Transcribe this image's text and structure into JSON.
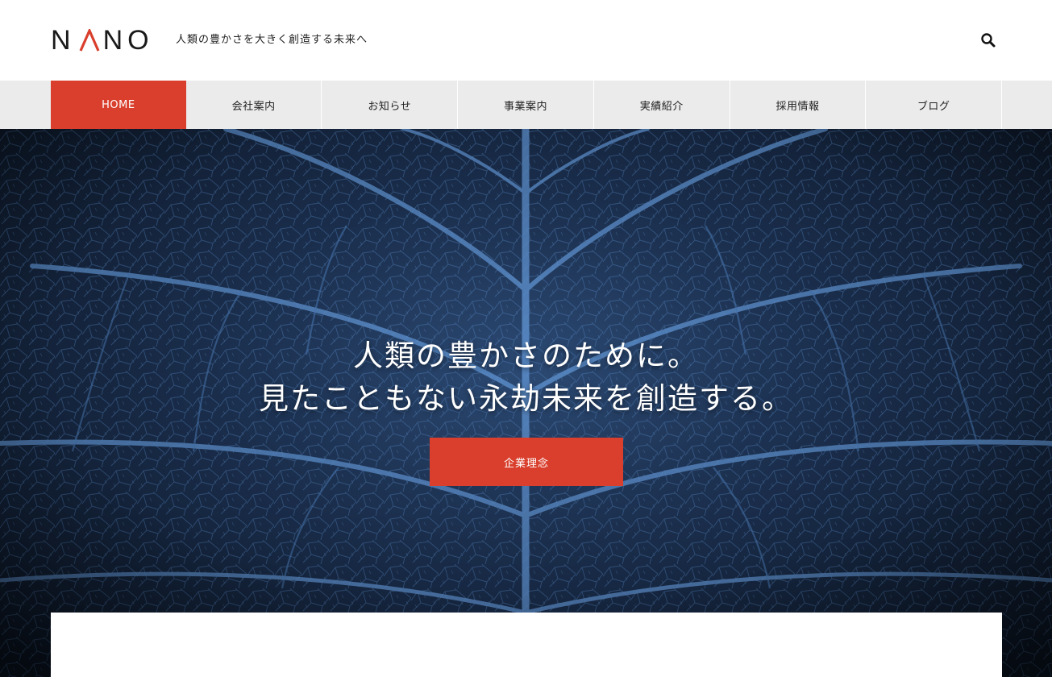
{
  "header": {
    "logo_text": "NANO",
    "tagline": "人類の豊かさを大きく創造する未来へ",
    "search_icon": "search-icon"
  },
  "nav": {
    "items": [
      {
        "label": "HOME",
        "active": true
      },
      {
        "label": "会社案内",
        "active": false
      },
      {
        "label": "お知らせ",
        "active": false
      },
      {
        "label": "事業案内",
        "active": false
      },
      {
        "label": "実績紹介",
        "active": false
      },
      {
        "label": "採用情報",
        "active": false
      },
      {
        "label": "ブログ",
        "active": false
      }
    ]
  },
  "hero": {
    "heading_line1": "人類の豊かさのために。",
    "heading_line2": "見たこともない永劫未来を創造する。",
    "cta_label": "企業理念"
  },
  "colors": {
    "accent": "#d93f2c",
    "nav_bg": "#ebebeb",
    "hero_dark": "#0e1a2c",
    "hero_vein": "#3f6ea8"
  }
}
